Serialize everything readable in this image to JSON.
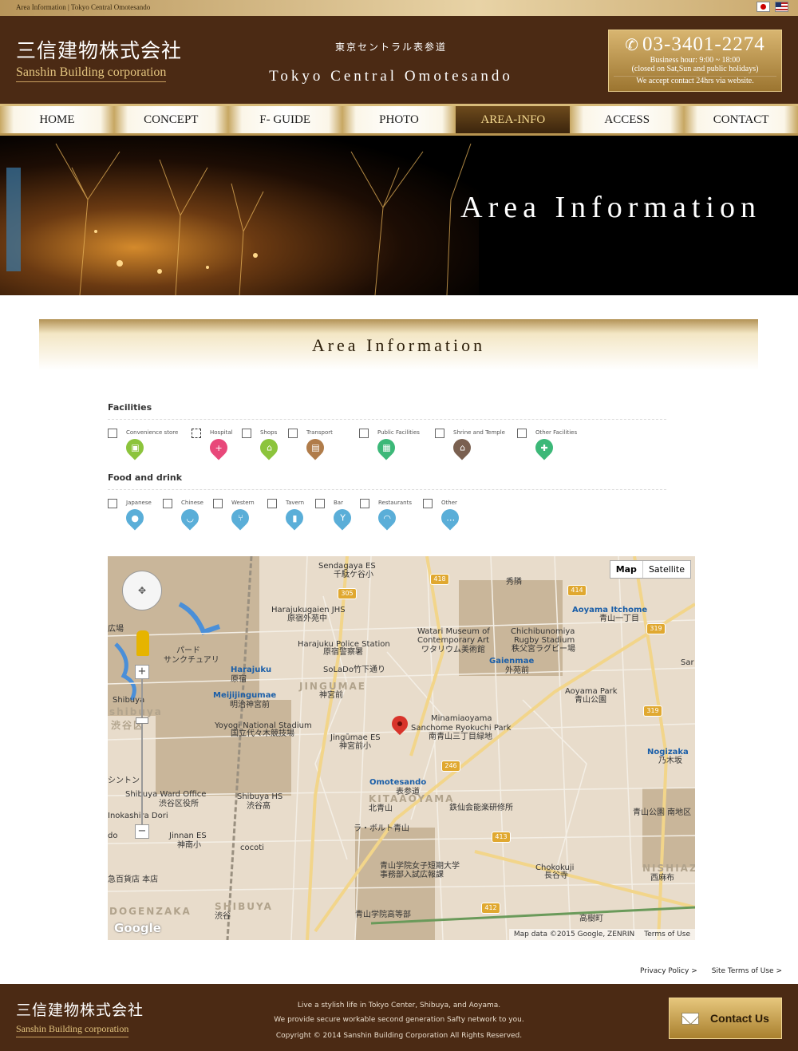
{
  "topbar": {
    "breadcrumb": "Area Information | Tokyo Central Omotesando",
    "flags": [
      "japan-flag",
      "us-flag"
    ]
  },
  "header": {
    "logo_jp": "三信建物株式会社",
    "logo_en": "Sanshin Building corporation",
    "subtitle_jp": "東京セントラル表参道",
    "subtitle_en": "Tokyo Central Omotesando",
    "phone": "03-3401-2274",
    "hours": "Business hour: 9:00 ~ 18:00",
    "closed": "(closed on Sat,Sun and public holidays)",
    "web_note": "We accept contact 24hrs via website."
  },
  "nav": {
    "items": [
      {
        "label": "HOME",
        "active": false
      },
      {
        "label": "CONCEPT",
        "active": false
      },
      {
        "label": "F- GUIDE",
        "active": false
      },
      {
        "label": "PHOTO",
        "active": false
      },
      {
        "label": "AREA-INFO",
        "active": true
      },
      {
        "label": "ACCESS",
        "active": false
      },
      {
        "label": "CONTACT",
        "active": false
      }
    ]
  },
  "hero": {
    "title": "Area Information"
  },
  "section": {
    "title": "Area Information"
  },
  "filters": {
    "facilities": {
      "title": "Facilities",
      "items": [
        {
          "label": "Convenience store",
          "color": "#8cc43c",
          "icon": "basket-icon"
        },
        {
          "label": "Hospital",
          "color": "#e8487a",
          "icon": "cross-icon"
        },
        {
          "label": "Shops",
          "color": "#8cc43c",
          "icon": "house-icon"
        },
        {
          "label": "Transport",
          "color": "#b07c4a",
          "icon": "train-icon"
        },
        {
          "label": "Public Facilities",
          "color": "#3cb878",
          "icon": "building-icon"
        },
        {
          "label": "Shrine and Temple",
          "color": "#7a6050",
          "icon": "temple-icon"
        },
        {
          "label": "Other Facilities",
          "color": "#3cb878",
          "icon": "facility-icon"
        }
      ]
    },
    "food": {
      "title": "Food and drink",
      "items": [
        {
          "label": "Japanese",
          "color": "#5aaed8",
          "icon": "japanese-icon"
        },
        {
          "label": "Chinese",
          "color": "#5aaed8",
          "icon": "bowl-icon"
        },
        {
          "label": "Western",
          "color": "#5aaed8",
          "icon": "cutlery-icon"
        },
        {
          "label": "Tavern",
          "color": "#5aaed8",
          "icon": "sake-icon"
        },
        {
          "label": "Bar",
          "color": "#5aaed8",
          "icon": "glass-icon"
        },
        {
          "label": "Restaurants",
          "color": "#5aaed8",
          "icon": "dish-icon"
        },
        {
          "label": "Other",
          "color": "#5aaed8",
          "icon": "other-food-icon"
        }
      ]
    }
  },
  "map": {
    "type_buttons": [
      "Map",
      "Satellite"
    ],
    "attribution": "Map data ©2015 Google, ZENRIN",
    "terms": "Terms of Use",
    "google": "Google",
    "labels": [
      "Sendagaya ES",
      "千駄ケ谷小",
      "Harajukugaien JHS",
      "原宿外苑中",
      "Harajuku Police Station",
      "原宿警察署",
      "Watari Museum of",
      "Contemporary Art",
      "ワタリウム美術館",
      "Chichibunomiya",
      "Rugby Stadium",
      "秩父宮ラグビー場",
      "Aoyama Itchome",
      "青山一丁目",
      "Gaienmae",
      "外苑前",
      "Aoyama Park",
      "青山公園",
      "Harajuku",
      "原宿",
      "Meijijingumae",
      "明治神宮前",
      "JINGUMAE",
      "神宮前",
      "SoLaDo竹下通り",
      "Yoyogi National Stadium",
      "国立代々木競技場",
      "Jingūmae ES",
      "神宮前小",
      "Minamiaoyama",
      "Sanchome Ryokuchi Park",
      "南青山三丁目緑地",
      "Nogizaka",
      "乃木坂",
      "Omotesando",
      "表参道",
      "KITAAOYAMA",
      "北青山",
      "鉄仙会能楽研修所",
      "Shibuya Ward Office",
      "渋谷区役所",
      "Shibuya HS",
      "渋谷高",
      "Jinnan ES",
      "神南小",
      "ラ・ボルト青山",
      "青山公園 南地区",
      "青山学院女子短期大学",
      "事務部入試広報課",
      "Chokokuji",
      "長谷寺",
      "NISHIAZABU",
      "西麻布",
      "DOGENZAKA",
      "SHIBUYA",
      "渋谷",
      "青山学院高等部",
      "高樹町",
      "Shibuya",
      "shibuya",
      "渋谷区",
      "パード",
      "サンクチュアリ",
      "秀隣",
      "Inokashira Dori",
      "cocoti",
      "広場",
      "シントン",
      "Sar",
      "急百貨店 本店",
      "do"
    ],
    "route_shields": [
      "305",
      "418",
      "414",
      "319",
      "319",
      "246",
      "413",
      "412"
    ]
  },
  "links": {
    "privacy": "Privacy Policy",
    "terms": "Site Terms of Use"
  },
  "footer": {
    "logo_jp": "三信建物株式会社",
    "logo_en": "Sanshin Building corporation",
    "line1": "Live a stylish life in Tokyo Center, Shibuya, and Aoyama.",
    "line2": "We provide secure workable second generation Safty network to you.",
    "copyright": "Copyright © 2014 Sanshin Building Corporation All Rights Reserved.",
    "contact_label": "Contact Us"
  }
}
